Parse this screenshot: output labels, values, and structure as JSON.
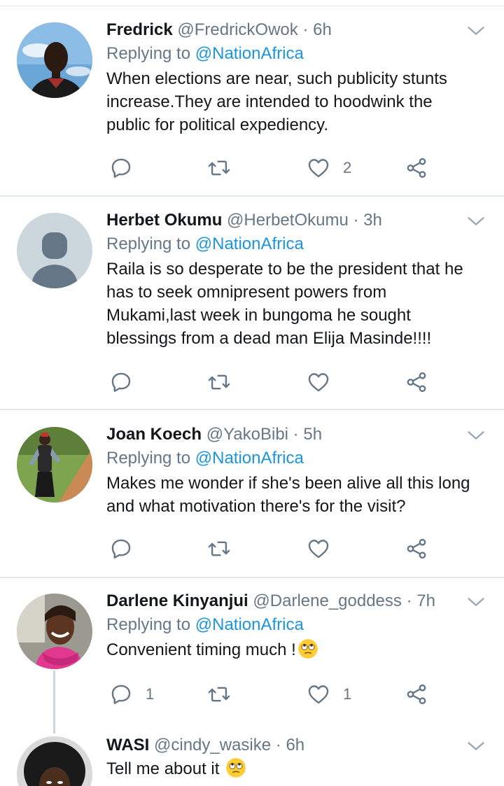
{
  "colors": {
    "accent": "#1b95e0",
    "muted": "#657786",
    "text": "#14171a",
    "divider": "#e1e8ed",
    "thread": "#ccd6dd"
  },
  "tweets": [
    {
      "name": "Fredrick",
      "handle": "@FredrickOwok",
      "dot": " · ",
      "time": "6h",
      "replying_prefix": "Replying to ",
      "replying_to": "@NationAfrica",
      "text": "When elections are near, such publicity stunts increase.They are intended to hoodwink the public for political expediency.",
      "reply_count": "",
      "retweet_count": "",
      "like_count": "2",
      "avatar": "photo-man-dark-shirt"
    },
    {
      "name": "Herbet Okumu",
      "handle": "@HerbetOkumu",
      "dot": " · ",
      "time": "3h",
      "replying_prefix": "Replying to ",
      "replying_to": "@NationAfrica",
      "text": "Raila is so desperate to be the president that he has to seek omnipresent powers from Mukami,last week in bungoma he sought blessings from a dead man Elija Masinde!!!!",
      "reply_count": "",
      "retweet_count": "",
      "like_count": "",
      "avatar": "default-silhouette"
    },
    {
      "name": "Joan Koech",
      "handle": "@YakoBibi",
      "dot": " · ",
      "time": "5h",
      "replying_prefix": "Replying to ",
      "replying_to": "@NationAfrica",
      "text": "Makes me wonder if she's been alive all this long and what motivation there's for the visit?",
      "reply_count": "",
      "retweet_count": "",
      "like_count": "",
      "avatar": "photo-woman-on-road"
    },
    {
      "name": "Darlene Kinyanjui",
      "handle": "@Darlene_goddess",
      "dot": " · ",
      "time": "7h",
      "replying_prefix": "Replying to ",
      "replying_to": "@NationAfrica",
      "text": "Convenient timing much !",
      "emoji": "eye-roll-emoji",
      "reply_count": "1",
      "retweet_count": "",
      "like_count": "1",
      "avatar": "photo-woman-smiling-pink-scarf"
    },
    {
      "name": "WASI",
      "handle": "@cindy_wasike",
      "dot": " · ",
      "time": "6h",
      "text": "Tell me about it ",
      "emoji": "eye-roll-emoji",
      "avatar": "photo-woman-curly-hair"
    }
  ],
  "icons": {
    "reply": "reply-icon",
    "retweet": "retweet-icon",
    "like": "heart-icon",
    "share": "share-icon",
    "more": "chevron-down-icon"
  }
}
